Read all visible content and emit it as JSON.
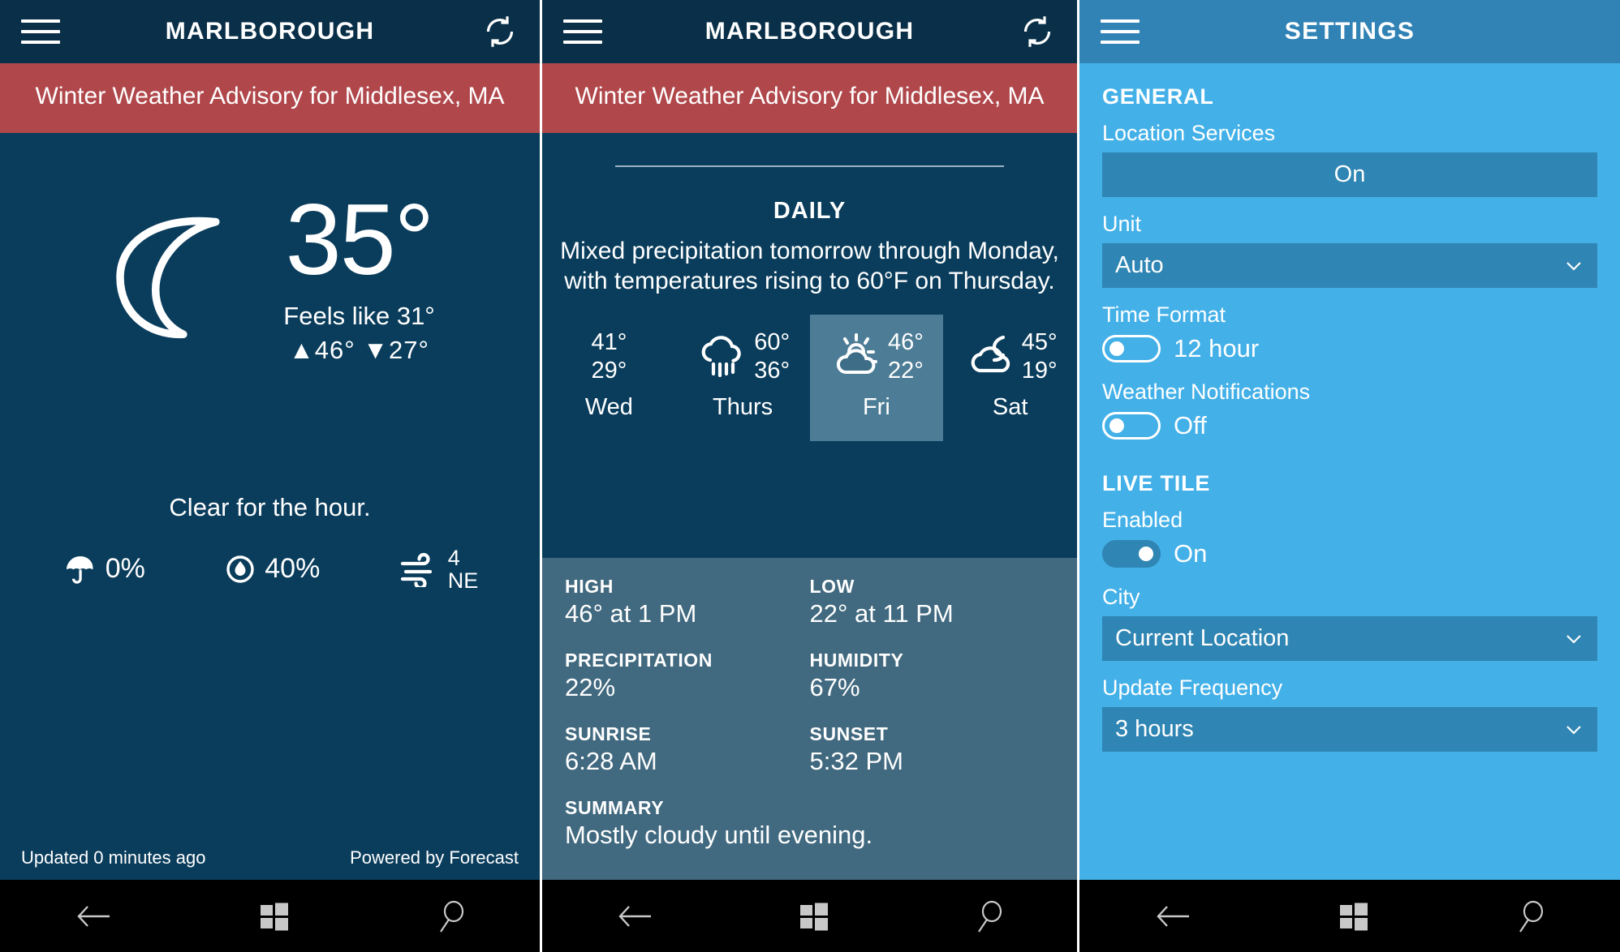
{
  "panels": {
    "home": {
      "appbar": {
        "title": "MARLBOROUGH",
        "menu_icon": "hamburger-icon",
        "refresh_icon": "refresh-icon"
      },
      "advisory": "Winter Weather Advisory for Middlesex, MA",
      "condition_icon": "moon-icon",
      "temperature": "35°",
      "feels_like": "Feels like  31°",
      "high_low": "▲46°  ▼27°",
      "hour_summary": "Clear for the hour.",
      "metrics": [
        {
          "icon": "umbrella-icon",
          "value": "0%"
        },
        {
          "icon": "humidity-drop-icon",
          "value": "40%"
        },
        {
          "icon": "wind-icon",
          "value": "4",
          "value2": "NE"
        }
      ],
      "updated": "Updated 0 minutes ago",
      "powered_by": "Powered by Forecast"
    },
    "daily": {
      "appbar": {
        "title": "MARLBOROUGH",
        "menu_icon": "hamburger-icon",
        "refresh_icon": "refresh-icon"
      },
      "advisory": "Winter Weather Advisory for Middlesex, MA",
      "section_title": "DAILY",
      "description": "Mixed precipitation tomorrow through Monday, with temperatures rising to 60°F on Thursday.",
      "days": [
        {
          "label": "Wed",
          "icon": "none",
          "high": "41°",
          "low": "29°",
          "selected": false
        },
        {
          "label": "Thurs",
          "icon": "rain-icon",
          "high": "60°",
          "low": "36°",
          "selected": false
        },
        {
          "label": "Fri",
          "icon": "sun-cloud-icon",
          "high": "46°",
          "low": "22°",
          "selected": true
        },
        {
          "label": "Sat",
          "icon": "cloud-moon-icon",
          "high": "45°",
          "low": "19°",
          "selected": false
        }
      ],
      "details": [
        {
          "key": "HIGH",
          "value": "46° at 1 PM"
        },
        {
          "key": "LOW",
          "value": "22° at 11 PM"
        },
        {
          "key": "PRECIPITATION",
          "value": "22%"
        },
        {
          "key": "HUMIDITY",
          "value": "67%"
        },
        {
          "key": "SUNRISE",
          "value": "6:28 AM"
        },
        {
          "key": "SUNSET",
          "value": "5:32 PM"
        }
      ],
      "summary": {
        "key": "SUMMARY",
        "value": "Mostly cloudy until evening."
      }
    },
    "settings": {
      "appbar": {
        "title": "SETTINGS",
        "menu_icon": "hamburger-icon"
      },
      "general_header": "GENERAL",
      "location_services": {
        "label": "Location Services",
        "value": "On"
      },
      "unit": {
        "label": "Unit",
        "value": "Auto"
      },
      "time_format": {
        "label": "Time Format",
        "value": "12 hour",
        "state": "off"
      },
      "weather_notifications": {
        "label": "Weather Notifications",
        "value": "Off",
        "state": "off"
      },
      "live_tile_header": "LIVE TILE",
      "enabled": {
        "label": "Enabled",
        "value": "On",
        "state": "on"
      },
      "city": {
        "label": "City",
        "value": "Current Location"
      },
      "update_frequency": {
        "label": "Update Frequency",
        "value": "3 hours"
      }
    }
  },
  "navbar": {
    "back_icon": "back-arrow-icon",
    "start_icon": "windows-start-icon",
    "search_icon": "search-icon"
  },
  "colors": {
    "dark_blue": "#0a3d5c",
    "appbar_dark": "#0a3049",
    "advisory_red": "#b0474b",
    "detail_panel": "#41697f",
    "selected_tile": "#4d7d96",
    "settings_header": "#3183b5",
    "settings_body": "#43b0e8",
    "settings_control": "#2f85b3"
  }
}
